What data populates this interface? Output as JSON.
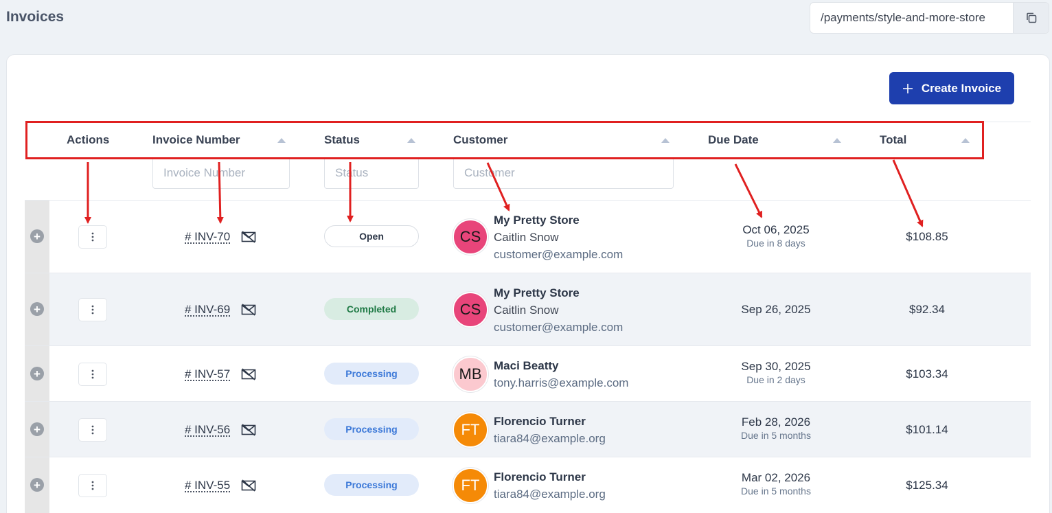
{
  "page": {
    "title": "Invoices"
  },
  "url_box": {
    "path": "/payments/style-and-more-store",
    "copy_icon": "copy-icon"
  },
  "create_button": {
    "label": "Create Invoice",
    "icon": "plus-icon"
  },
  "columns": [
    {
      "label": "Actions",
      "sortable": false
    },
    {
      "label": "Invoice Number",
      "sortable": true,
      "filter_placeholder": "Invoice Number"
    },
    {
      "label": "Status",
      "sortable": true,
      "filter_placeholder": "Status"
    },
    {
      "label": "Customer",
      "sortable": true,
      "filter_placeholder": "Customer"
    },
    {
      "label": "Due Date",
      "sortable": true
    },
    {
      "label": "Total",
      "sortable": true
    }
  ],
  "rows": [
    {
      "invoice": "# INV-70",
      "status": "Open",
      "avatar_initials": "CS",
      "avatar_color": "#e8457a",
      "avatar_text_color": "#1a1a1a",
      "customer_store": "My Pretty Store",
      "customer_name": "Caitlin Snow",
      "customer_email": "customer@example.com",
      "due_date": "Oct 06, 2025",
      "due_relative": "Due in 8 days",
      "total": "$108.85"
    },
    {
      "invoice": "# INV-69",
      "status": "Completed",
      "avatar_initials": "CS",
      "avatar_color": "#e8457a",
      "avatar_text_color": "#1a1a1a",
      "customer_store": "My Pretty Store",
      "customer_name": "Caitlin Snow",
      "customer_email": "customer@example.com",
      "due_date": "Sep 26, 2025",
      "due_relative": "",
      "total": "$92.34"
    },
    {
      "invoice": "# INV-57",
      "status": "Processing",
      "avatar_initials": "MB",
      "avatar_color": "#fbc9cf",
      "avatar_text_color": "#1a1a1a",
      "customer_store": "Maci Beatty",
      "customer_name": "",
      "customer_email": "tony.harris@example.com",
      "due_date": "Sep 30, 2025",
      "due_relative": "Due in 2 days",
      "total": "$103.34"
    },
    {
      "invoice": "# INV-56",
      "status": "Processing",
      "avatar_initials": "FT",
      "avatar_color": "#f58a07",
      "avatar_text_color": "#ffffff",
      "customer_store": "Florencio Turner",
      "customer_name": "",
      "customer_email": "tiara84@example.org",
      "due_date": "Feb 28, 2026",
      "due_relative": "Due in 5 months",
      "total": "$101.14"
    },
    {
      "invoice": "# INV-55",
      "status": "Processing",
      "avatar_initials": "FT",
      "avatar_color": "#f58a07",
      "avatar_text_color": "#ffffff",
      "customer_store": "Florencio Turner",
      "customer_name": "",
      "customer_email": "tiara84@example.org",
      "due_date": "Mar 02, 2026",
      "due_relative": "Due in 5 months",
      "total": "$125.34"
    }
  ],
  "status_colors": {
    "Open": {
      "bg": "#ffffff",
      "fg": "#2d3748",
      "border": "#d9dde3"
    },
    "Completed": {
      "bg": "#d8ece2",
      "fg": "#1f7a45",
      "border": "#d8ece2"
    },
    "Processing": {
      "bg": "#e2ebfa",
      "fg": "#3b78d8",
      "border": "#e2ebfa"
    }
  },
  "annotation_color": "#e02020"
}
